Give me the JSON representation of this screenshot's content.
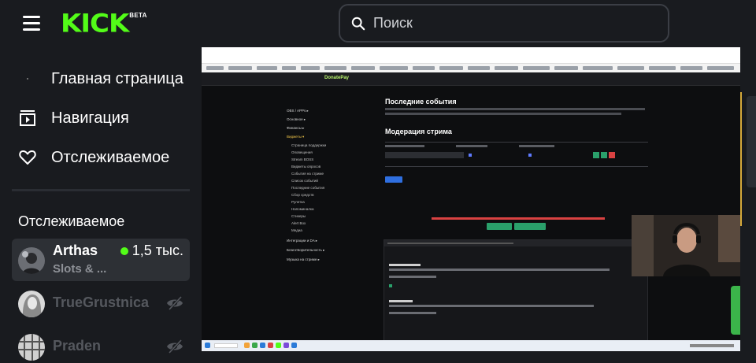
{
  "header": {
    "logo_text": "KICK",
    "logo_badge": "BETA",
    "search_placeholder": "Поиск",
    "brand_color": "#53fc18"
  },
  "sidebar": {
    "nav": [
      {
        "label": "Главная страница",
        "icon": "home-icon"
      },
      {
        "label": "Навигация",
        "icon": "browse-icon"
      },
      {
        "label": "Отслеживаемое",
        "icon": "heart-icon"
      }
    ],
    "followed_title": "Отслеживаемое",
    "channels": [
      {
        "name": "Arthas",
        "category": "Slots & ...",
        "viewers": "1,5 тыс.",
        "live": true
      },
      {
        "name": "TrueGrustnica",
        "live": false
      },
      {
        "name": "Praden",
        "live": false
      }
    ]
  },
  "stream": {
    "site_logo": "DonatePay",
    "heading_events": "Последние события",
    "heading_moderation": "Модерация стрима"
  }
}
